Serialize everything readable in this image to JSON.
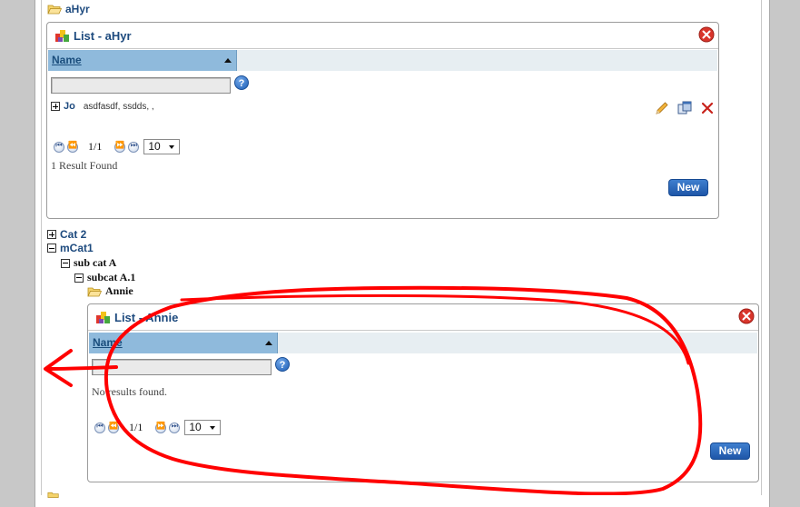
{
  "tree": {
    "top_node": "aHyr",
    "cat2": "Cat 2",
    "mcat1": "mCat1",
    "sub_cat_a": "sub cat A",
    "subcat_a1": "subcat A.1",
    "annie": "Annie"
  },
  "panel1": {
    "title": "List - aHyr",
    "column_name": "Name",
    "row": {
      "name": "Jo",
      "description": "asdfasdf, ssdds, ,"
    },
    "page": "1/1",
    "page_size": "10",
    "result_text": "1 Result Found",
    "new_label": "New"
  },
  "panel2": {
    "title": "List - Annie",
    "column_name": "Name",
    "empty_text": "No results found.",
    "page": "1/1",
    "page_size": "10",
    "new_label": "New"
  },
  "help_label": "?",
  "colors": {
    "accent_blue": "#1e56a8",
    "header_blue": "#8fbadc",
    "annotation_red": "#ff0000"
  }
}
